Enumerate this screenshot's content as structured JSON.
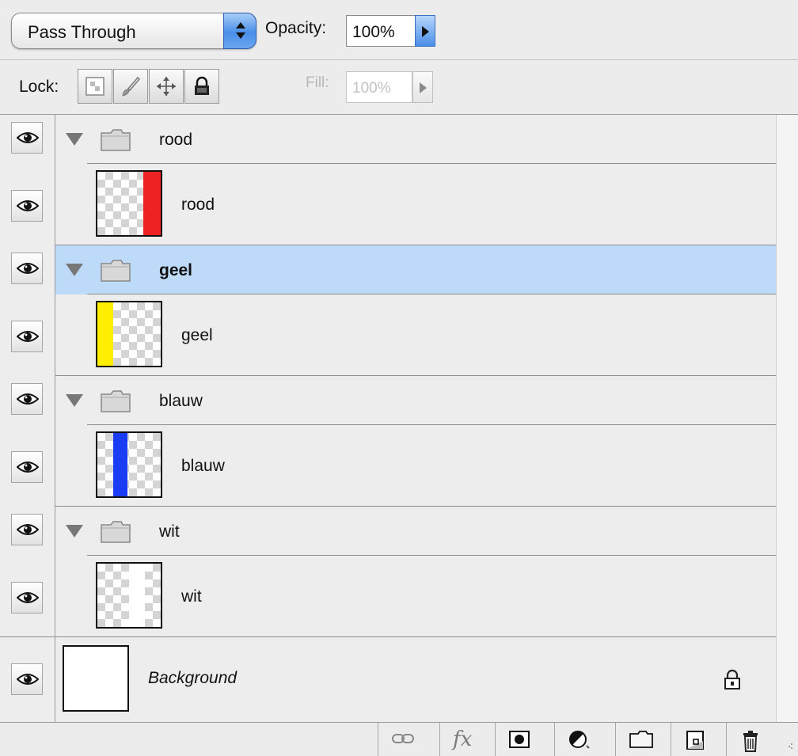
{
  "blend_mode": {
    "selected": "Pass Through"
  },
  "opacity": {
    "label": "Opacity:",
    "value": "100%"
  },
  "lock": {
    "label": "Lock:"
  },
  "fill": {
    "label": "Fill:",
    "value": "100%"
  },
  "layers": [
    {
      "type": "group",
      "name": "rood",
      "visible": true,
      "expanded": true,
      "selected": false
    },
    {
      "type": "layer",
      "name": "rood",
      "visible": true,
      "stripe_color": "#ee2222"
    },
    {
      "type": "group",
      "name": "geel",
      "visible": true,
      "expanded": true,
      "selected": true
    },
    {
      "type": "layer",
      "name": "geel",
      "visible": true,
      "stripe_color": "#ffee00"
    },
    {
      "type": "group",
      "name": "blauw",
      "visible": true,
      "expanded": true,
      "selected": false
    },
    {
      "type": "layer",
      "name": "blauw",
      "visible": true,
      "stripe_color": "#1a3cf5"
    },
    {
      "type": "group",
      "name": "wit",
      "visible": true,
      "expanded": true,
      "selected": false
    },
    {
      "type": "layer",
      "name": "wit",
      "visible": true,
      "stripe_color": "#ffffff"
    },
    {
      "type": "background",
      "name": "Background",
      "visible": true,
      "locked": true
    }
  ],
  "bottom_bar": {
    "buttons": [
      "link-layers-icon",
      "layer-style-fx-icon",
      "layer-mask-icon",
      "adjustment-layer-icon",
      "new-group-icon",
      "new-layer-icon",
      "trash-icon"
    ],
    "fx_label": "fx"
  },
  "colors": {
    "selection": "#bedaf9",
    "accent_blue": "#4a8ee8"
  }
}
